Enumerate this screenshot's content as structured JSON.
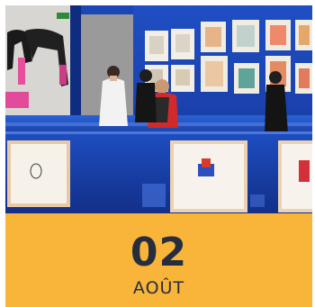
{
  "event": {
    "day": "02",
    "month": "AOÛT",
    "image_description_icon": "exhibition-photo",
    "colors": {
      "band": "#f9b43a",
      "text": "#262d3d",
      "wall": "#1b46b6"
    }
  }
}
